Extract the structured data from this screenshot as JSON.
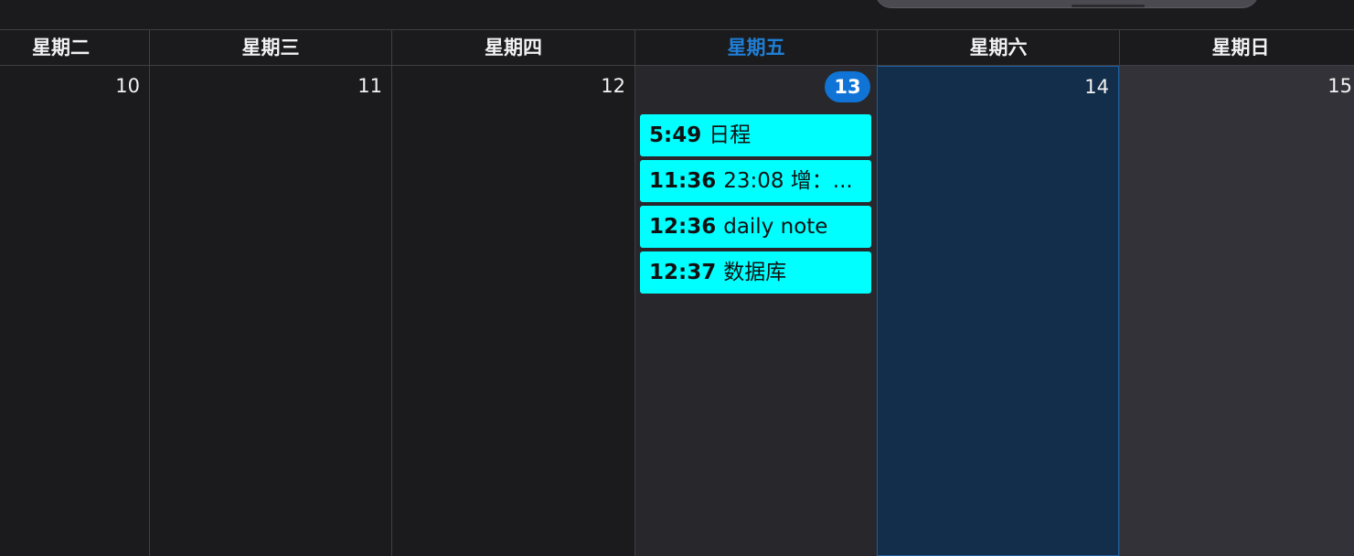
{
  "weekdays": [
    "星期二",
    "星期三",
    "星期四",
    "星期五",
    "星期六",
    "星期日"
  ],
  "days": [
    "10",
    "11",
    "12",
    "13",
    "14",
    "15"
  ],
  "today_index": 3,
  "selected_index": 4,
  "events": [
    {
      "time": "5:49",
      "title": "日程"
    },
    {
      "time": "11:36",
      "title": "23:08 增：..."
    },
    {
      "time": "12:36",
      "title": "daily note"
    },
    {
      "time": "12:37",
      "title": "数据库"
    }
  ],
  "colors": {
    "background": "#1b1b1e",
    "today_header": "#1f7fd6",
    "today_badge": "#0f74d6",
    "event_fill": "#00ffff",
    "selected_cell": "#132e4a",
    "weekend_cell": "#323238"
  }
}
